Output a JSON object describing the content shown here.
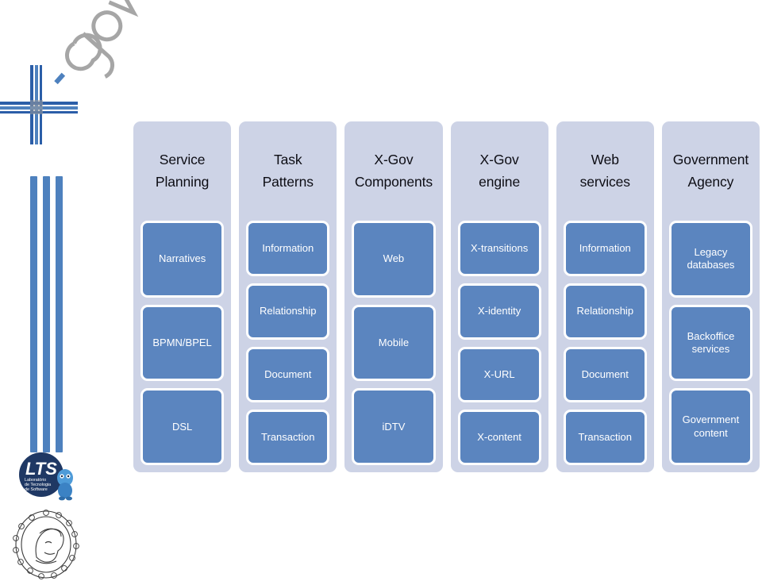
{
  "branding": {
    "wordmark": "X-gov",
    "wordmark_icon": "xgov-cross-logo",
    "stripes_icon": "blue-stripes-decoration",
    "stripe_count": 3,
    "stripe_color": "#4E81BE",
    "lts_logo": {
      "icon": "lts-logo",
      "acronym": "LTS",
      "line1": "Laboratório",
      "line2": "de Tecnologia",
      "line3": "de Software"
    },
    "crest_logo": {
      "icon": "university-crest-logo"
    }
  },
  "colors": {
    "panel_background": "#CDD3E6",
    "box_fill": "#5B85BF",
    "box_border": "#FFFFFF",
    "box_text": "#FFFFFF",
    "header_text": "#0D0D14",
    "page_background": "#FFFFFF"
  },
  "diagram": {
    "type": "layered-architecture-columns",
    "column_count": 6,
    "columns": [
      {
        "id": "service-planning",
        "header": "Service\nPlanning",
        "boxes": [
          {
            "label": "Narratives"
          },
          {
            "label": "BPMN/BPEL"
          },
          {
            "label": "DSL"
          }
        ]
      },
      {
        "id": "task-patterns",
        "header": "Task\nPatterns",
        "boxes": [
          {
            "label": "Information"
          },
          {
            "label": "Relationship"
          },
          {
            "label": "Document"
          },
          {
            "label": "Transaction"
          }
        ]
      },
      {
        "id": "x-gov-components",
        "header": "X-Gov\nComponents",
        "boxes": [
          {
            "label": "Web"
          },
          {
            "label": "Mobile"
          },
          {
            "label": "iDTV"
          }
        ]
      },
      {
        "id": "x-gov-engine",
        "header": "X-Gov\nengine",
        "boxes": [
          {
            "label": "X-transitions"
          },
          {
            "label": "X-identity"
          },
          {
            "label": "X-URL"
          },
          {
            "label": "X-content"
          }
        ]
      },
      {
        "id": "web-services",
        "header": "Web\nservices",
        "boxes": [
          {
            "label": "Information"
          },
          {
            "label": "Relationship"
          },
          {
            "label": "Document"
          },
          {
            "label": "Transaction"
          }
        ]
      },
      {
        "id": "government-agency",
        "header": "Government\nAgency",
        "boxes": [
          {
            "label": "Legacy\ndatabases"
          },
          {
            "label": "Backoffice\nservices"
          },
          {
            "label": "Government\ncontent"
          }
        ]
      }
    ]
  }
}
